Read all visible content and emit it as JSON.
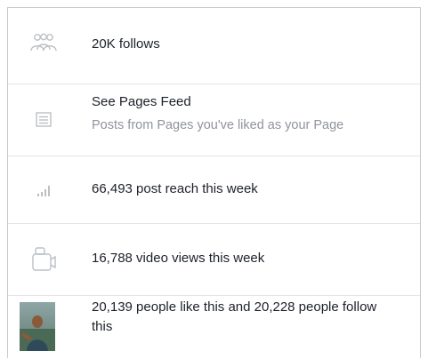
{
  "rows": {
    "follows": {
      "text": "20K follows",
      "icon": "people-icon"
    },
    "pages_feed": {
      "title": "See Pages Feed",
      "subtitle": "Posts from Pages you've liked as your Page",
      "icon": "feed-icon"
    },
    "reach": {
      "text": "66,493 post reach this week",
      "icon": "bar-chart-icon"
    },
    "video": {
      "text": "16,788 video views this week",
      "icon": "video-camera-icon"
    },
    "likes": {
      "text": "20,139 people like this and 20,228 people follow this",
      "icon": "avatar"
    }
  },
  "colors": {
    "text": "#1d2129",
    "muted": "#90949c",
    "icon": "#bcc0c4",
    "divider": "#e4e4e4"
  }
}
